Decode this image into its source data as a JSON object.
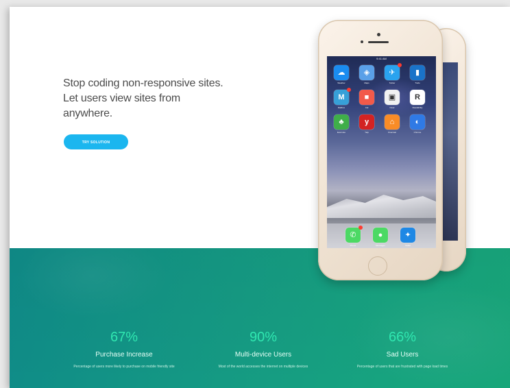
{
  "hero": {
    "headline_lines": [
      "Stop coding non-responsive sites.",
      "Let users view sites from",
      "anywhere."
    ],
    "cta_label": "TRY SOLUTION"
  },
  "phone": {
    "status_time": "9:41 AM",
    "apps": [
      {
        "name": "Weather",
        "icon": "weather-icon",
        "color": "#1a8cf0",
        "glyph": "☁"
      },
      {
        "name": "Maps",
        "icon": "maps-icon",
        "color": "#5aa0e8",
        "glyph": "◈"
      },
      {
        "name": "Twitter",
        "icon": "twitter-icon",
        "color": "#2aa3ef",
        "glyph": "✈"
      },
      {
        "name": "Trello",
        "icon": "trello-icon",
        "color": "#1a73c9",
        "glyph": "▮"
      },
      {
        "name": "Mailbox",
        "icon": "mailbox-icon",
        "color": "#37a0d8",
        "glyph": "M"
      },
      {
        "name": "Cal",
        "icon": "calendar-icon",
        "color": "#f25a4a",
        "glyph": "■"
      },
      {
        "name": "Clear",
        "icon": "clear-icon",
        "color": "#f2f2f2",
        "glyph": "▣"
      },
      {
        "name": "Readability",
        "icon": "readability-icon",
        "color": "#ffffff",
        "glyph": "R"
      },
      {
        "name": "Evernote",
        "icon": "evernote-icon",
        "color": "#3fae49",
        "glyph": "♣"
      },
      {
        "name": "Yelp",
        "icon": "yelp-icon",
        "color": "#d32323",
        "glyph": "y"
      },
      {
        "name": "Overcast",
        "icon": "overcast-icon",
        "color": "#f98c27",
        "glyph": "⌂"
      },
      {
        "name": "Chrome",
        "icon": "chrome-icon",
        "color": "#2f7ae5",
        "glyph": "◐"
      }
    ],
    "dock": [
      {
        "name": "Phone",
        "icon": "phone-icon",
        "color": "#4cd964",
        "glyph": "✆"
      },
      {
        "name": "Messages",
        "icon": "messages-icon",
        "color": "#4cd964",
        "glyph": "●"
      },
      {
        "name": "Safari",
        "icon": "safari-icon",
        "color": "#1e88e5",
        "glyph": "✦"
      }
    ]
  },
  "stats": [
    {
      "value": "67%",
      "label": "Purchase Increase",
      "desc": "Percentage of users more likely to purchase on mobile friendly site"
    },
    {
      "value": "90%",
      "label": "Multi-device Users",
      "desc": "Most of the world accesses the internet on multiple devices"
    },
    {
      "value": "66%",
      "label": "Sad Users",
      "desc": "Percentage of users that are frustrated with page load times"
    }
  ],
  "colors": {
    "accent": "#1bb6ef",
    "stat_value": "#30e7b0",
    "band_start": "#0f8b88",
    "band_end": "#18a67a"
  }
}
